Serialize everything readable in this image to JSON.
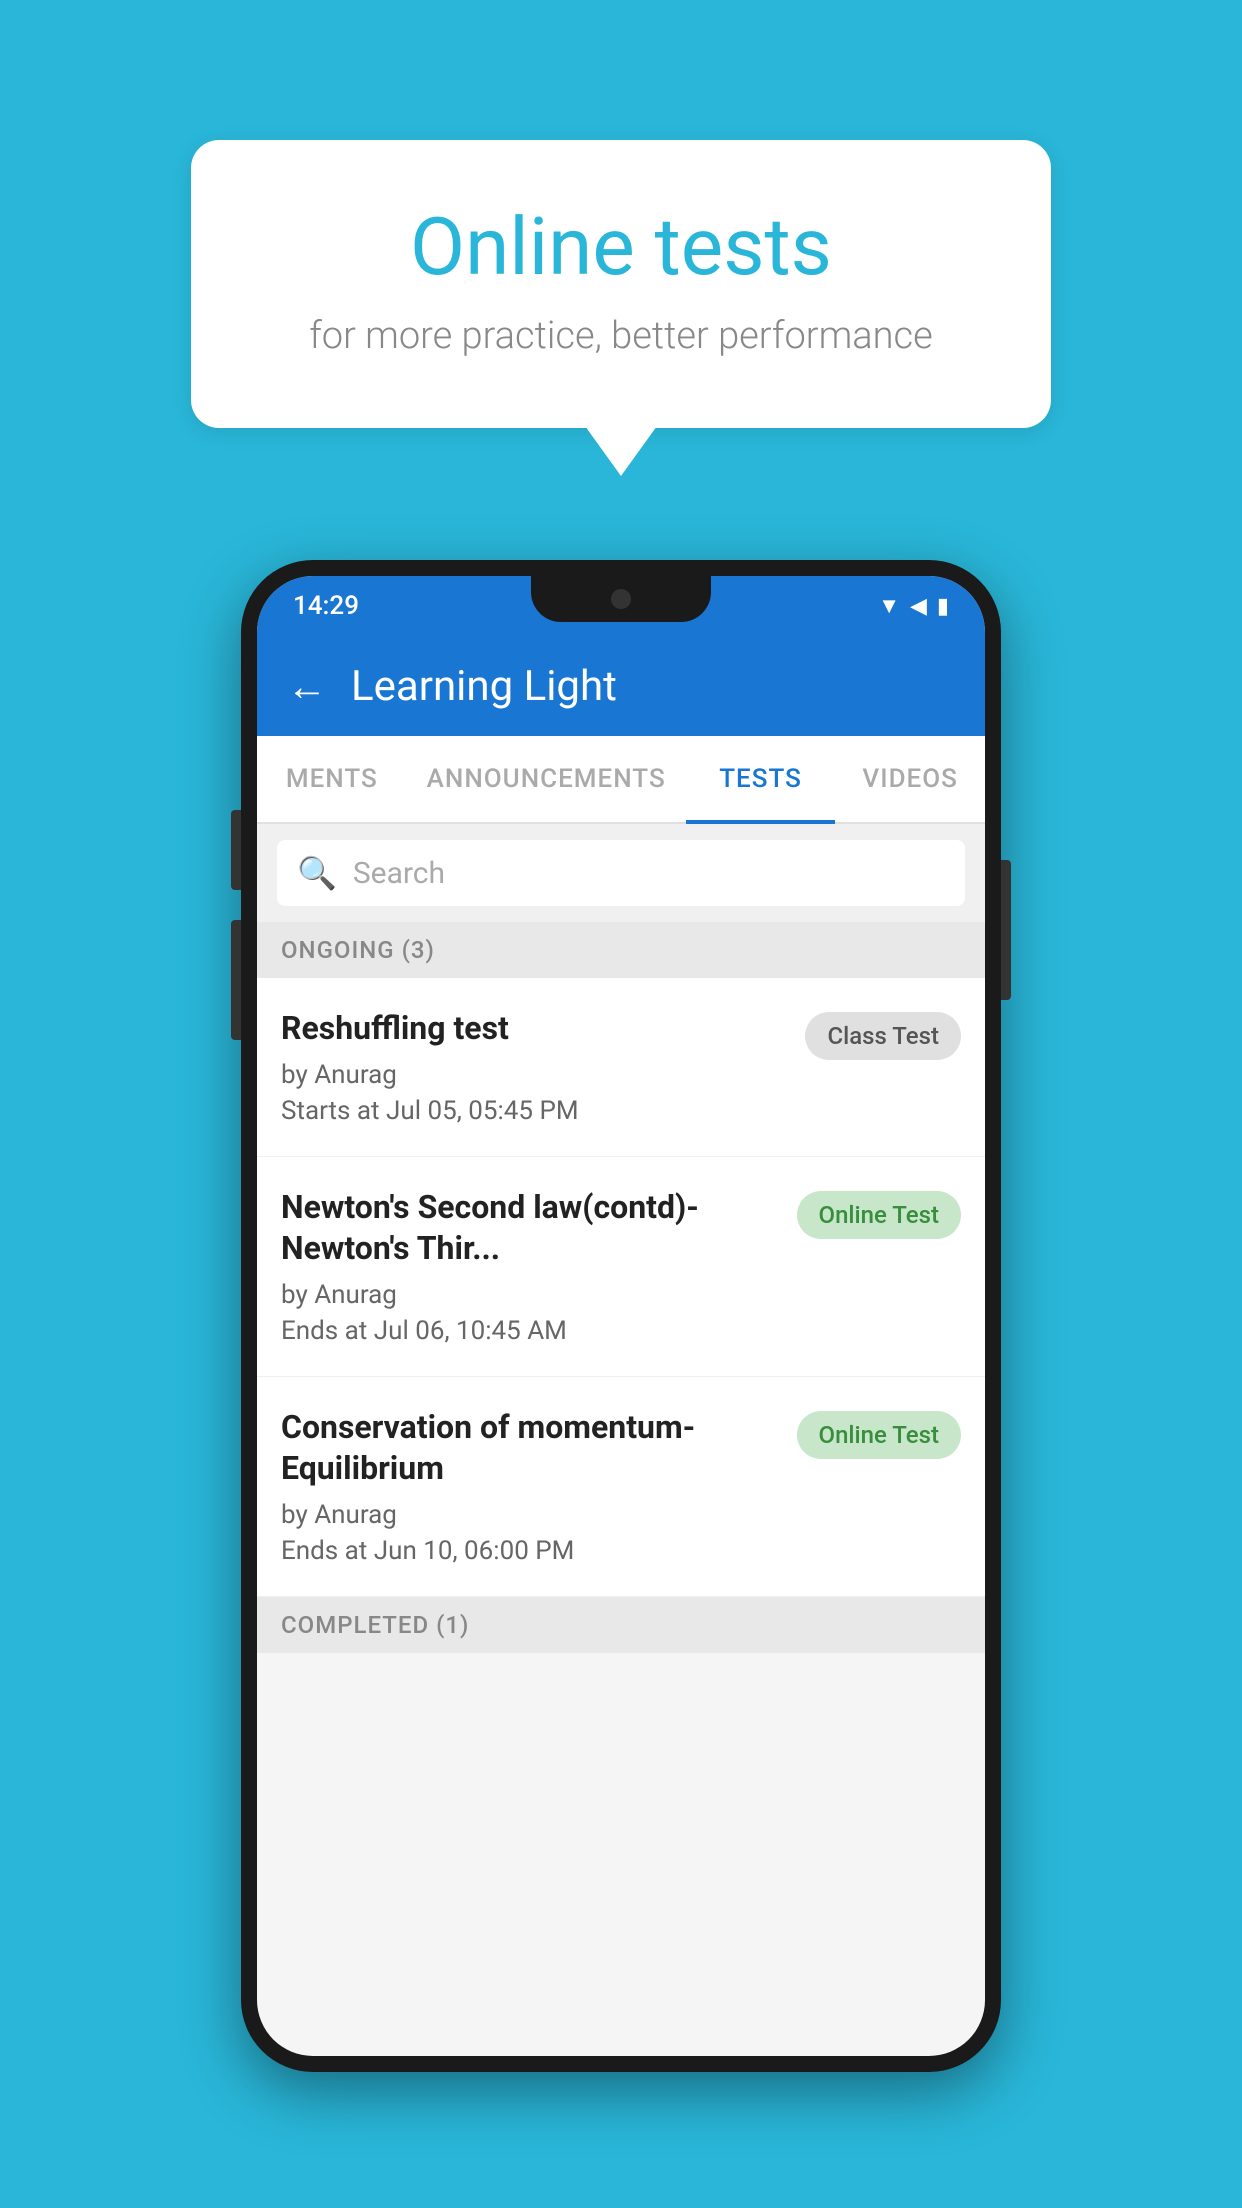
{
  "background_color": "#29b6d8",
  "bubble": {
    "title": "Online tests",
    "subtitle": "for more practice, better performance"
  },
  "phone": {
    "status_bar": {
      "time": "14:29",
      "icons": [
        "wifi",
        "signal",
        "battery"
      ]
    },
    "app_bar": {
      "back_label": "←",
      "title": "Learning Light"
    },
    "tabs": [
      {
        "label": "MENTS",
        "active": false
      },
      {
        "label": "ANNOUNCEMENTS",
        "active": false
      },
      {
        "label": "TESTS",
        "active": true
      },
      {
        "label": "VIDEOS",
        "active": false
      }
    ],
    "search": {
      "placeholder": "Search"
    },
    "sections": [
      {
        "header": "ONGOING (3)",
        "items": [
          {
            "name": "Reshuffling test",
            "author": "by Anurag",
            "time_label": "Starts at",
            "time": "Jul 05, 05:45 PM",
            "badge": "Class Test",
            "badge_type": "class"
          },
          {
            "name": "Newton's Second law(contd)-Newton's Thir...",
            "author": "by Anurag",
            "time_label": "Ends at",
            "time": "Jul 06, 10:45 AM",
            "badge": "Online Test",
            "badge_type": "online"
          },
          {
            "name": "Conservation of momentum-Equilibrium",
            "author": "by Anurag",
            "time_label": "Ends at",
            "time": "Jun 10, 06:00 PM",
            "badge": "Online Test",
            "badge_type": "online"
          }
        ]
      }
    ],
    "completed_section": "COMPLETED (1)"
  }
}
